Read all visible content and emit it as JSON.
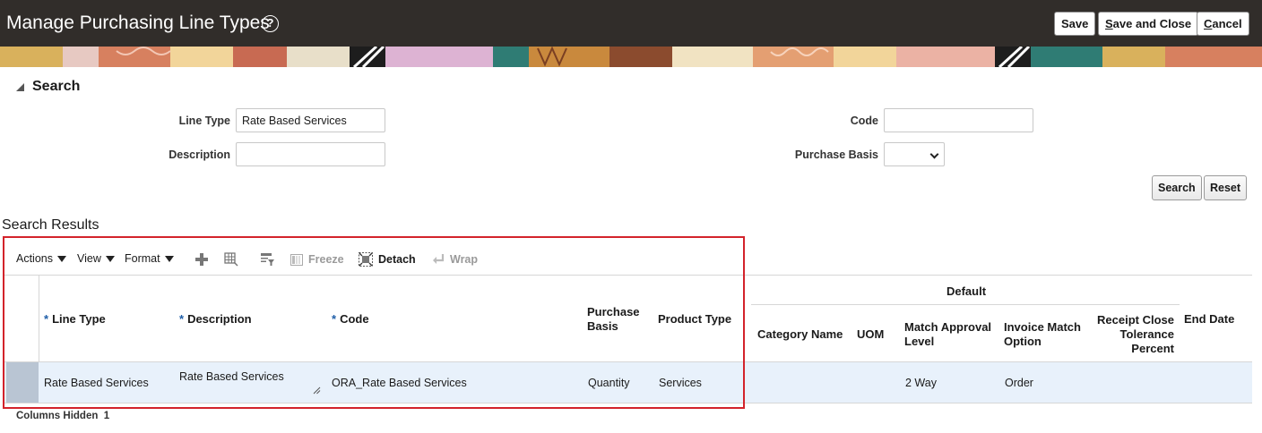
{
  "header": {
    "title": "Manage Purchasing Line Types",
    "help_icon": "?",
    "buttons": {
      "save": "Save",
      "save_and_close_u": "S",
      "save_and_close_rest": "ave and Close",
      "cancel_u": "C",
      "cancel_rest": "ancel"
    }
  },
  "search": {
    "heading": "Search",
    "line_type": {
      "label": "Line Type",
      "value": "Rate Based Services"
    },
    "description": {
      "label": "Description",
      "value": ""
    },
    "code": {
      "label": "Code",
      "value": ""
    },
    "purchase_basis": {
      "label": "Purchase Basis",
      "value": ""
    },
    "search_button": "Search",
    "reset_button": "Reset"
  },
  "results": {
    "title": "Search Results",
    "toolbar": {
      "actions": "Actions",
      "view": "View",
      "format": "Format",
      "freeze": "Freeze",
      "detach": "Detach",
      "wrap": "Wrap"
    },
    "group_header": "Default",
    "columns": {
      "line_type": "Line Type",
      "description": "Description",
      "code": "Code",
      "purchase_basis_1": "Purchase",
      "purchase_basis_2": "Basis",
      "product_type": "Product Type",
      "category_name": "Category Name",
      "uom": "UOM",
      "match_approval_1": "Match Approval",
      "match_approval_2": "Level",
      "invoice_match_1": "Invoice Match",
      "invoice_match_2": "Option",
      "receipt_close_1": "Receipt Close",
      "receipt_close_2": "Tolerance",
      "receipt_close_3": "Percent",
      "end_date": "End Date"
    },
    "rows": [
      {
        "line_type": "Rate Based Services",
        "description": "Rate Based Services",
        "code": "ORA_Rate Based Services",
        "purchase_basis": "Quantity",
        "product_type": "Services",
        "category_name": "",
        "uom": "",
        "match_approval_level": "2 Way",
        "invoice_match_option": "Order",
        "receipt_close_tolerance": "",
        "end_date": ""
      }
    ],
    "footer": {
      "label": "Columns Hidden",
      "count": "1"
    }
  },
  "icons": {
    "help": "help-icon",
    "add": "plus-icon",
    "columns": "column-settings-icon",
    "filter": "query-by-example-icon",
    "freeze": "freeze-icon",
    "detach": "detach-icon",
    "wrap": "wrap-icon"
  },
  "colors": {
    "header_bg": "#312d2a",
    "highlight_frame": "#d3232b",
    "row_selected": "#e8f1fb",
    "required_star": "#1f5ea8"
  }
}
